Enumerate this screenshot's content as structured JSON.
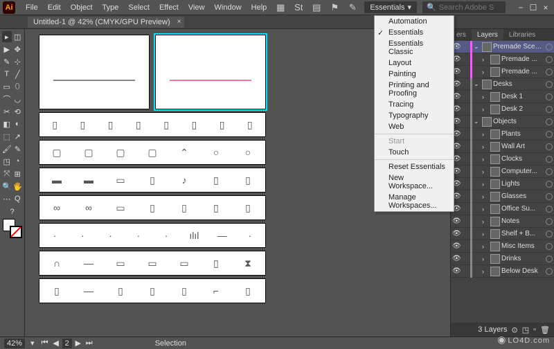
{
  "app": {
    "icon_label": "Ai"
  },
  "menubar": {
    "items": [
      "File",
      "Edit",
      "Object",
      "Type",
      "Select",
      "Effect",
      "View",
      "Window",
      "Help"
    ]
  },
  "workspace": {
    "current": "Essentials",
    "menu": [
      {
        "label": "Automation",
        "type": "item"
      },
      {
        "label": "Essentials",
        "type": "item",
        "checked": true
      },
      {
        "label": "Essentials Classic",
        "type": "item"
      },
      {
        "label": "Layout",
        "type": "item"
      },
      {
        "label": "Painting",
        "type": "item"
      },
      {
        "label": "Printing and Proofing",
        "type": "item"
      },
      {
        "label": "Tracing",
        "type": "item"
      },
      {
        "label": "Typography",
        "type": "item"
      },
      {
        "label": "Web",
        "type": "item"
      },
      {
        "type": "sep"
      },
      {
        "label": "Start",
        "type": "item",
        "disabled": true
      },
      {
        "label": "Touch",
        "type": "item"
      },
      {
        "type": "sep"
      },
      {
        "label": "Reset Essentials",
        "type": "item"
      },
      {
        "label": "New Workspace...",
        "type": "item"
      },
      {
        "label": "Manage Workspaces...",
        "type": "item"
      }
    ]
  },
  "search": {
    "placeholder": "Search Adobe Stock"
  },
  "document": {
    "tab_title": "Untitled-1 @ 42% (CMYK/GPU Preview)"
  },
  "layers_panel": {
    "tabs": [
      "ers",
      "Layers",
      "Libraries"
    ],
    "active_tab": 1,
    "rows": [
      {
        "name": "Premade Scenes",
        "color": "#ff55ff",
        "selected": true,
        "expanded": true,
        "level": 0
      },
      {
        "name": "Premade ...",
        "color": "#ff55ff",
        "level": 1
      },
      {
        "name": "Premade ...",
        "color": "#ff55ff",
        "level": 1
      },
      {
        "name": "Desks",
        "color": "#888",
        "expanded": true,
        "level": 0
      },
      {
        "name": "Desk 1",
        "color": "#888",
        "level": 1
      },
      {
        "name": "Desk 2",
        "color": "#888",
        "level": 1
      },
      {
        "name": "Objects",
        "color": "#888",
        "expanded": true,
        "level": 0
      },
      {
        "name": "Plants",
        "color": "#888",
        "level": 1
      },
      {
        "name": "Wall Art",
        "color": "#888",
        "level": 1
      },
      {
        "name": "Clocks",
        "color": "#888",
        "level": 1
      },
      {
        "name": "Computer...",
        "color": "#888",
        "level": 1
      },
      {
        "name": "Lights",
        "color": "#888",
        "level": 1
      },
      {
        "name": "Glasses",
        "color": "#888",
        "level": 1
      },
      {
        "name": "Office Su...",
        "color": "#888",
        "level": 1
      },
      {
        "name": "Notes",
        "color": "#888",
        "level": 1
      },
      {
        "name": "Shelf + B...",
        "color": "#888",
        "level": 1
      },
      {
        "name": "Misc Items",
        "color": "#888",
        "level": 1
      },
      {
        "name": "Drinks",
        "color": "#888",
        "level": 1
      },
      {
        "name": "Below Desk",
        "color": "#888",
        "level": 1
      }
    ]
  },
  "statusbar": {
    "zoom": "42%",
    "artboard_current": "2",
    "tool": "Selection",
    "layer_count": "3 Layers"
  },
  "watermark": "LO4D.com",
  "icons": {
    "chevron_down": "▾",
    "search": "🔍",
    "minimize": "−",
    "maximize": "☐",
    "close": "×",
    "eye": "👁",
    "expand_open": "⌄",
    "expand_closed": "›",
    "first": "⏮",
    "prev": "◀",
    "next": "▶",
    "last": "⏭"
  },
  "toolbox_glyphs": [
    [
      "▸",
      "◫"
    ],
    [
      "▶",
      "✥"
    ],
    [
      "✎",
      "⊹"
    ],
    [
      "T",
      "╱"
    ],
    [
      "▭",
      "⬯"
    ],
    [
      "⌒",
      "◡"
    ],
    [
      "✂",
      "⟲"
    ],
    [
      "◧",
      "◐"
    ],
    [
      "⬚",
      "↗"
    ],
    [
      "🖌",
      "✎"
    ],
    [
      "◳",
      "◔"
    ],
    [
      "⤧",
      "⊞"
    ],
    [
      "🔍",
      "🖐"
    ],
    [
      "⋯",
      "Q"
    ]
  ],
  "artstrip_icons": [
    [
      "▯",
      "▯",
      "▯",
      "▯",
      "▯",
      "▯",
      "▯",
      "▯"
    ],
    [
      "▢",
      "▢",
      "▢",
      "▢",
      "⌃",
      "○",
      "○"
    ],
    [
      "▬",
      "▬",
      "▭",
      "▯",
      "♪",
      "▯",
      "▯"
    ],
    [
      "∞",
      "∞",
      "▭",
      "▯",
      "▯",
      "▯",
      "▯"
    ],
    [
      "·",
      "·",
      "·",
      "·",
      "·",
      "ılıl",
      "—",
      "·"
    ],
    [
      "∩",
      "—",
      "▭",
      "▭",
      "▭",
      "▯",
      "⧗"
    ],
    [
      "▯",
      "—",
      "▯",
      "▯",
      "▯",
      "⌐",
      "▯"
    ]
  ]
}
